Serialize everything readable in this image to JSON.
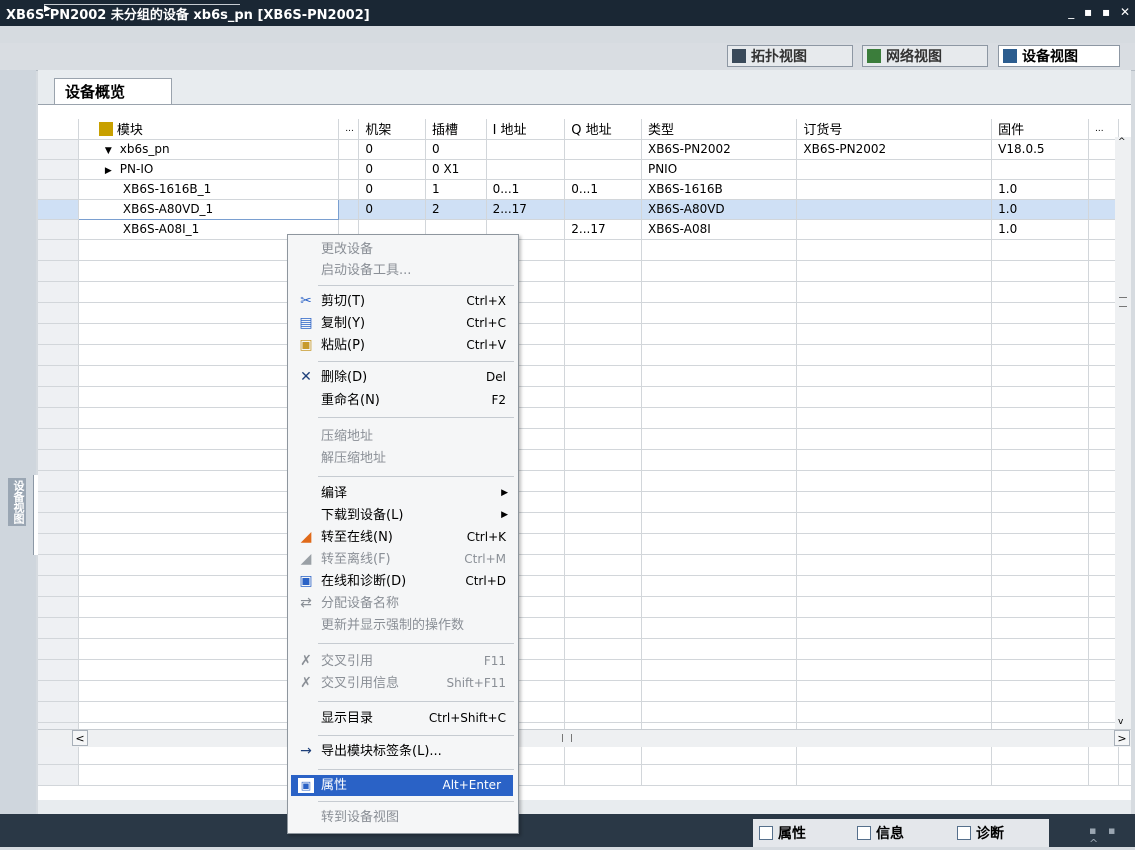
{
  "title": {
    "crumb1": "XB6S-PN2002",
    "crumb2": "未分组的设备",
    "crumb3": "xb6s_pn [XB6S-PN2002]",
    "sep": "▶",
    "window_buttons": "_ ▪ ▪ ✕"
  },
  "view_tabs": {
    "topology": "拓扑视图",
    "network": "网络视图",
    "device": "设备视图"
  },
  "side_label": "设备视图",
  "overview_tab": "设备概览",
  "table": {
    "headers": [
      "模块",
      "...",
      "机架",
      "插槽",
      "I 地址",
      "Q 地址",
      "类型",
      "订货号",
      "固件",
      "..."
    ],
    "rows": [
      {
        "arrow": "▼",
        "name": "xb6s_pn",
        "rack": "0",
        "slot": "0",
        "i_addr": "",
        "q_addr": "",
        "type": "XB6S-PN2002",
        "order": "XB6S-PN2002",
        "firmware": "V18.0.5"
      },
      {
        "arrow": "▶",
        "name": "PN-IO",
        "rack": "0",
        "slot": "0 X1",
        "i_addr": "",
        "q_addr": "",
        "type": "PNIO",
        "order": "",
        "firmware": ""
      },
      {
        "arrow": "",
        "name": "XB6S-1616B_1",
        "rack": "0",
        "slot": "1",
        "i_addr": "0...1",
        "q_addr": "0...1",
        "type": "XB6S-1616B",
        "order": "",
        "firmware": "1.0"
      },
      {
        "arrow": "",
        "name": "XB6S-A80VD_1",
        "rack": "0",
        "slot": "2",
        "i_addr": "2...17",
        "q_addr": "",
        "type": "XB6S-A80VD",
        "order": "",
        "firmware": "1.0"
      },
      {
        "arrow": "",
        "name": "XB6S-A08I_1",
        "rack": "",
        "slot": "",
        "i_addr": "",
        "q_addr": "2...17",
        "type": "XB6S-A08I",
        "order": "",
        "firmware": "1.0"
      }
    ]
  },
  "context_menu": {
    "change_device": "更改设备",
    "start_tool": "启动设备工具...",
    "cut": "剪切(T)",
    "cut_sc": "Ctrl+X",
    "copy": "复制(Y)",
    "copy_sc": "Ctrl+C",
    "paste": "粘贴(P)",
    "paste_sc": "Ctrl+V",
    "delete": "删除(D)",
    "delete_sc": "Del",
    "rename": "重命名(N)",
    "rename_sc": "F2",
    "compress": "压缩地址",
    "decompress": "解压缩地址",
    "compile": "编译",
    "download": "下载到设备(L)",
    "go_online": "转至在线(N)",
    "go_online_sc": "Ctrl+K",
    "go_offline": "转至离线(F)",
    "go_offline_sc": "Ctrl+M",
    "online_diag": "在线和诊断(D)",
    "online_diag_sc": "Ctrl+D",
    "assign_name": "分配设备名称",
    "update_force": "更新并显示强制的操作数",
    "cross_ref": "交叉引用",
    "cross_ref_sc": "F11",
    "cross_ref_info": "交叉引用信息",
    "cross_ref_info_sc": "Shift+F11",
    "show_catalog": "显示目录",
    "show_catalog_sc": "Ctrl+Shift+C",
    "export_labels": "导出模块标签条(L)...",
    "properties": "属性",
    "properties_sc": "Alt+Enter",
    "goto_device_view": "转到设备视图"
  },
  "bottom_tabs": {
    "properties": "属性",
    "info": "信息",
    "diagnostics": "诊断"
  },
  "colors": {
    "titlebar": "#1a2734",
    "highlight": "#2a62c6",
    "selected_row": "#cfe0f5"
  }
}
